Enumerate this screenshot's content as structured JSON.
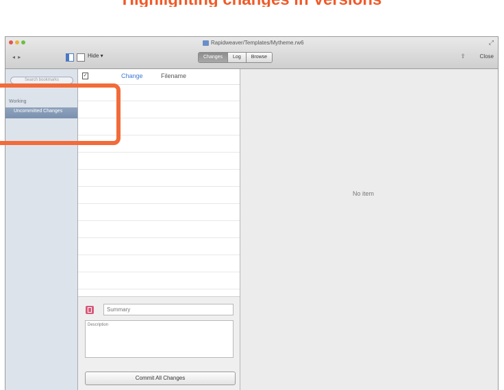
{
  "headline": "Highlighting changes in Versions",
  "window": {
    "title": "Rapidweaver/Templates/Mytheme.rw6",
    "nav_arrows": "◂ ▸",
    "view_menu": "Hide ▾",
    "segments": [
      "Changes",
      "Log",
      "Browse"
    ],
    "share_icon": "⇧",
    "close_button": "Close"
  },
  "sidebar": {
    "search_placeholder": "Search bookmarks",
    "heading": "Working",
    "selected_item": "Uncommitted Changes"
  },
  "list": {
    "change_link": "Change",
    "sort_label": "Filename",
    "row_count": 12
  },
  "editor": {
    "name_placeholder": "Summary",
    "description_placeholder": "Description",
    "commit_button": "Commit All Changes"
  },
  "detail": {
    "empty_text": "No item"
  },
  "colors": {
    "highlight": "#f26b3a",
    "sidebar_selection": "#7a91ae",
    "link": "#3a78d6"
  }
}
